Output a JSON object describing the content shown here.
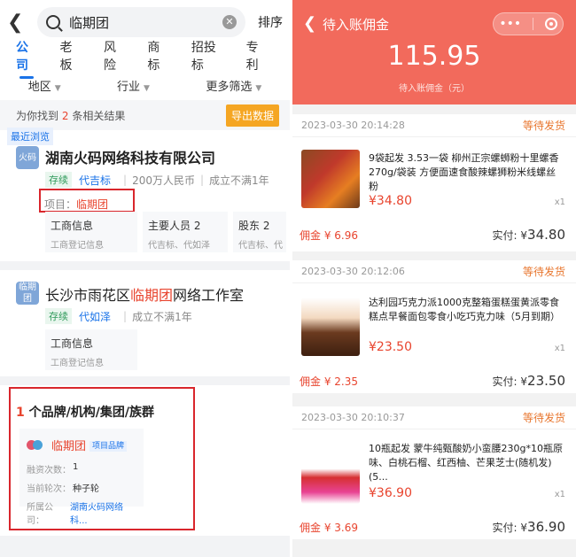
{
  "left": {
    "search": {
      "query": "临期团",
      "sort": "排序"
    },
    "tabs": [
      "公司",
      "老板",
      "风险",
      "商标",
      "招投标",
      "专利"
    ],
    "filters": {
      "region": "地区",
      "industry": "行业",
      "more": "更多筛选"
    },
    "result": {
      "prefix": "为你找到",
      "count": "2",
      "suffix": "条相关结果",
      "export": "导出数据"
    },
    "recent_tag": "最近浏览",
    "company1": {
      "logo": "火码",
      "name": "湖南火码网络科技有限公司",
      "status": "存续",
      "person": "代吉标",
      "capital": "200万人民币",
      "age": "成立不满1年",
      "project_label": "项目：",
      "project_value": "临期团",
      "boxes": [
        {
          "title": "工商信息",
          "sub": "工商登记信息"
        },
        {
          "title": "主要人员 2",
          "sub": "代吉标、代如泽"
        },
        {
          "title": "股东 2",
          "sub": "代吉标、代"
        }
      ]
    },
    "company2": {
      "logo": "临期团",
      "name_pre": "长沙市雨花区",
      "name_hl": "临期团",
      "name_post": "网络工作室",
      "status": "存续",
      "person": "代如泽",
      "age": "成立不满1年",
      "box": {
        "title": "工商信息",
        "sub": "工商登记信息"
      }
    },
    "brand": {
      "count": "1",
      "title": "个品牌/机构/集团/族群",
      "name": "临期团",
      "badge": "项目品牌",
      "rows": [
        {
          "k": "融资次数：",
          "v": "1"
        },
        {
          "k": "当前轮次：",
          "v": "种子轮"
        },
        {
          "k": "所属公司：",
          "v": "湖南火码网络科..."
        }
      ]
    }
  },
  "right": {
    "title": "待入账佣金",
    "capsule_dots": "•••",
    "amount": "115.95",
    "amount_label": "待入账佣金（元）",
    "orders": [
      {
        "time": "2023-03-30 20:14:28",
        "status": "等待发货",
        "name": "9袋起发 3.53一袋 柳州正宗螺蛳粉十里螺香270g/袋装 方便面速食酸辣螺狮粉米线螺丝粉",
        "price": "¥34.80",
        "qty": "x1",
        "commission": "佣金 ¥ 6.96",
        "paid_label": "实付: ¥",
        "paid": "34.80"
      },
      {
        "time": "2023-03-30 20:12:06",
        "status": "等待发货",
        "name": "达利园巧克力派1000克整箱蛋糕蛋黄派零食糕点早餐面包零食小吃巧克力味（5月到期）",
        "price": "¥23.50",
        "qty": "x1",
        "commission": "佣金 ¥ 2.35",
        "paid_label": "实付: ¥",
        "paid": "23.50"
      },
      {
        "time": "2023-03-30 20:10:37",
        "status": "等待发货",
        "name": "10瓶起发 蒙牛纯甄酸奶小蛮腰230g*10瓶原味、白桃石榴、红西柚、芒果芝士(随机发)(5...",
        "price": "¥36.90",
        "qty": "x1",
        "commission": "佣金 ¥ 3.69",
        "paid_label": "实付: ¥",
        "paid": "36.90"
      }
    ]
  },
  "colors": {
    "accent": "#1a73e8",
    "header": "#f26a5c",
    "highlight": "#d9262c",
    "price": "#e8442e"
  }
}
